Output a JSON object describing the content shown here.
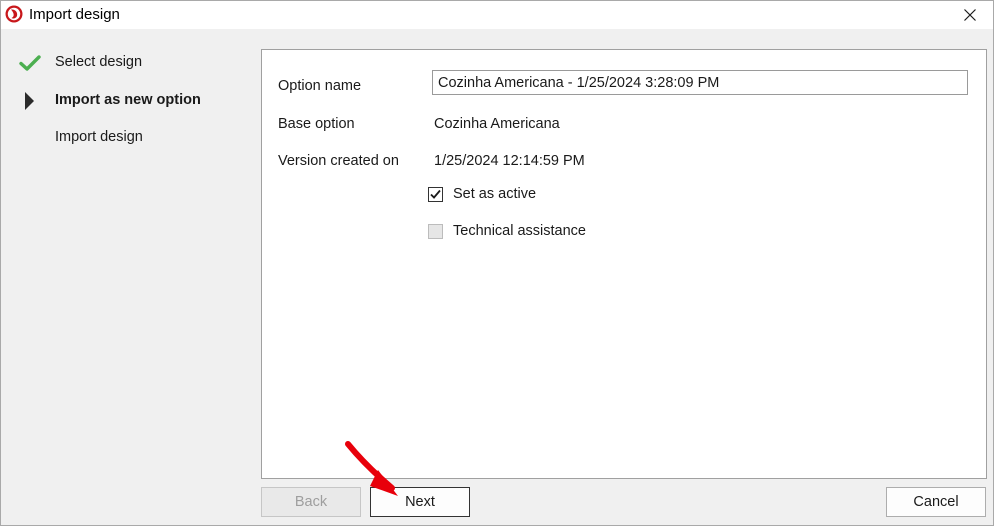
{
  "window": {
    "title": "Import design"
  },
  "steps": [
    {
      "label": "Select design",
      "status": "done",
      "icon": "checkmark-icon"
    },
    {
      "label": "Import as new option",
      "status": "current",
      "icon": "current-step-arrow-icon"
    },
    {
      "label": "Import design",
      "status": "pending",
      "icon": ""
    }
  ],
  "form": {
    "option_name_label": "Option name",
    "option_name_value": "Cozinha Americana - 1/25/2024 3:28:09 PM",
    "base_option_label": "Base option",
    "base_option_value": "Cozinha Americana",
    "version_created_label": "Version created on",
    "version_created_value": "1/25/2024 12:14:59 PM",
    "set_active_label": "Set as active",
    "set_active_checked": true,
    "technical_assistance_label": "Technical assistance",
    "technical_assistance_checked": false
  },
  "buttons": {
    "back": "Back",
    "next": "Next",
    "cancel": "Cancel"
  },
  "colors": {
    "check_green": "#4caf50",
    "accent_red": "#e0191b",
    "arrow_red": "#e8000b"
  }
}
